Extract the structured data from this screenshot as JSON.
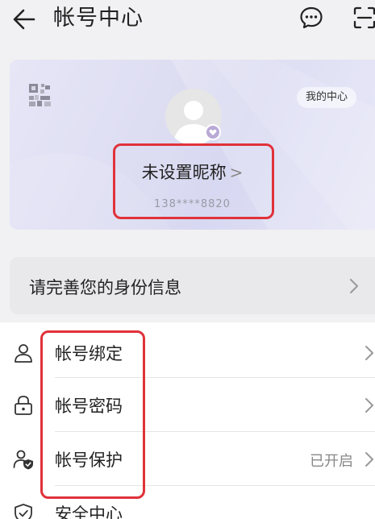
{
  "header": {
    "title": "帐号中心",
    "icons": {
      "back": "back-arrow-icon",
      "chat": "chat-bubble-icon",
      "scan": "scan-icon"
    }
  },
  "profile": {
    "my_center": "我的中心",
    "nickname": "未设置昵称",
    "nickname_chevron": ">",
    "phone_masked": "138****8820",
    "icons": {
      "qr": "qr-code-icon",
      "avatar": "default-avatar-icon"
    }
  },
  "identity": {
    "label": "请完善您的身份信息"
  },
  "account_items": [
    {
      "label": "帐号绑定",
      "status": "",
      "icon": "person-icon"
    },
    {
      "label": "帐号密码",
      "status": "",
      "icon": "lock-icon"
    },
    {
      "label": "帐号保护",
      "status": "已开启",
      "icon": "person-shield-icon"
    },
    {
      "label": "安全中心",
      "status": "",
      "icon": "shield-check-icon"
    }
  ],
  "colors": {
    "highlight": "#e0323a",
    "background": "#f1f1f3",
    "card_gradient_start": "#e7e6f7",
    "card_gradient_end": "#d7d8f1"
  }
}
